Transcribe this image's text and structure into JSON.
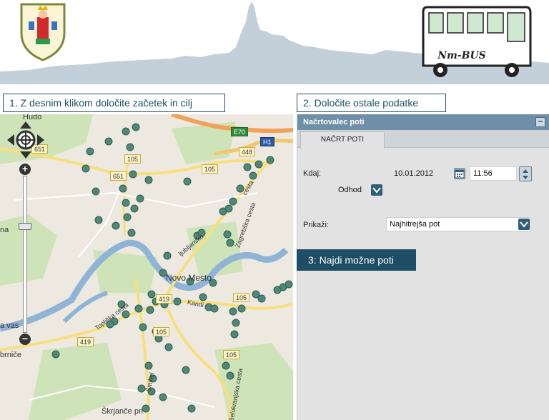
{
  "header": {
    "bus_label": "Nm-BUS",
    "crest": "city-coat-of-arms",
    "bus_logo": "bus-drawing-logo"
  },
  "steps": {
    "step1": "1. Z desnim klikom določite začetek in cilj",
    "step2": "2. Določite ostale podatke"
  },
  "map": {
    "labels": {
      "novo_mesto": "Novo Mesto",
      "hudo": "Hudo",
      "na": "na",
      "sa_vas": "a vas",
      "brnice": "brniče",
      "skrjance": "Škrjanče pri",
      "toplice": "Topliška cesta",
      "kandija": "Kandi",
      "ljubljanska": "ljubljanska",
      "zagrebska": "Zagrebška cesta",
      "smihel": "Šmihel",
      "belokranjska": "Belokranjska cesta",
      "cesta": "cesta"
    },
    "badges": {
      "e70": "E70",
      "h1": "H1",
      "r651a": "651",
      "r651b": "651",
      "r105a": "105",
      "r105b": "105",
      "r105c": "105",
      "r105d": "105",
      "r105e": "105",
      "r419a": "419",
      "r419b": "419",
      "r448": "448"
    },
    "controls": {
      "zoom_in": "+",
      "zoom_out": "−"
    }
  },
  "panel": {
    "title": "Načrtovalec poti",
    "collapse": "−",
    "tab": "NAČRT POTI",
    "when_label": "Kdaj:",
    "date": "10.01.2012",
    "time": "11:56",
    "mode": "Odhod",
    "show_label": "Prikaži:",
    "show_value": "Najhitrejša pot",
    "find_button": "3: Najdi možne poti"
  },
  "colors": {
    "accent": "#1e4d66",
    "panel_header": "#6f8fa6",
    "stop_marker": "#4f8878",
    "river": "#8fb4d6"
  }
}
